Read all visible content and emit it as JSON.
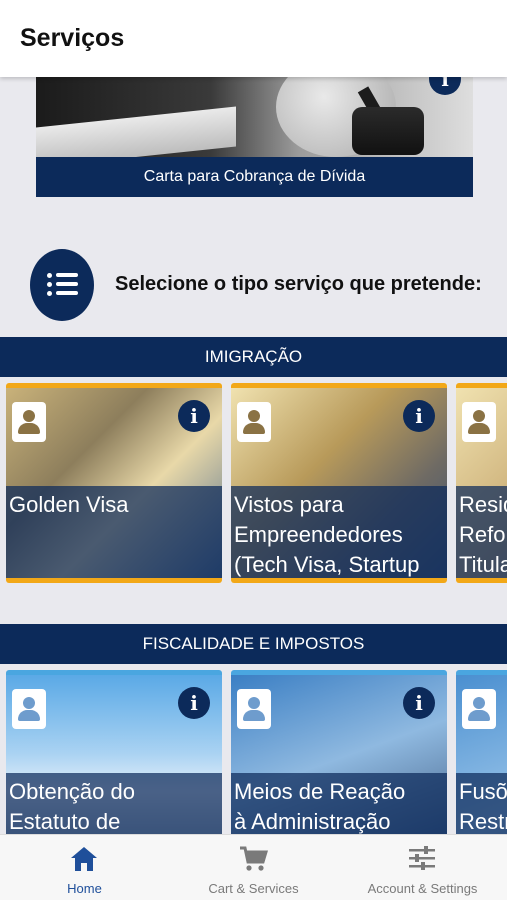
{
  "header": {
    "title": "Serviços"
  },
  "hero": {
    "caption": "Carta para Cobrança de Dívida",
    "info_glyph": "i"
  },
  "prompt": {
    "text": "Selecione o tipo serviço que pretende:",
    "icon": "list-icon"
  },
  "sections": [
    {
      "title": "IMIGRAÇÃO",
      "accent": "#f2a818",
      "cards": [
        {
          "title": "Golden Visa",
          "info_glyph": "i"
        },
        {
          "title": "Vistos para\nEmpreendedores\n(Tech Visa, Startup",
          "info_glyph": "i"
        },
        {
          "title": "Resid\nRefor\nTitula",
          "info_glyph": ""
        }
      ]
    },
    {
      "title": "FISCALIDADE E IMPOSTOS",
      "accent": "#4aa6e0",
      "cards": [
        {
          "title": "Obtenção do\nEstatuto de",
          "info_glyph": "i"
        },
        {
          "title": "Meios de Reação\nà Administração",
          "info_glyph": "i"
        },
        {
          "title": "Fusõ\nRestr",
          "info_glyph": ""
        }
      ]
    }
  ],
  "bottom_nav": [
    {
      "label": "Home",
      "icon": "home-icon",
      "active": true
    },
    {
      "label": "Cart & Services",
      "icon": "cart-icon",
      "active": false
    },
    {
      "label": "Account & Settings",
      "icon": "sliders-icon",
      "active": false
    }
  ],
  "colors": {
    "navy": "#0c2a5a",
    "active_nav": "#1f4f9a",
    "inactive_nav": "#7a7a7a"
  }
}
